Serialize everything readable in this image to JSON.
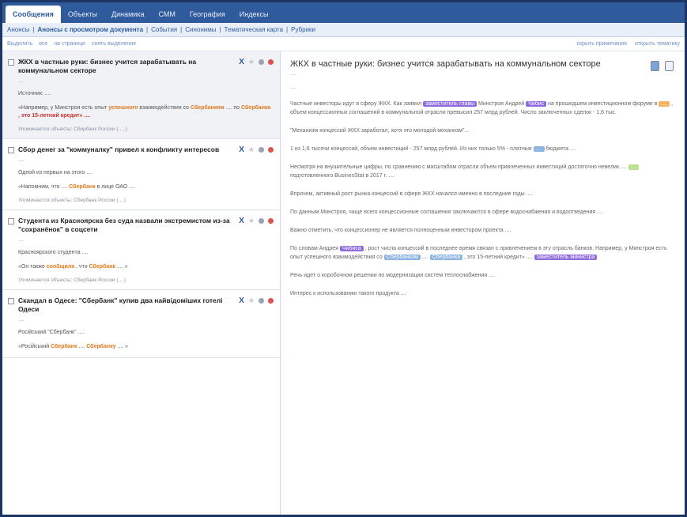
{
  "tabs": [
    {
      "label": "Сообщения",
      "active": true
    },
    {
      "label": "Объекты"
    },
    {
      "label": "Динамика"
    },
    {
      "label": "СММ"
    },
    {
      "label": "География"
    },
    {
      "label": "Индексы"
    }
  ],
  "subnav": {
    "items": [
      "Анонсы",
      "Анонсы с просмотром документа",
      "События",
      "Синонимы",
      "Тематическая карта",
      "Рубрики"
    ],
    "sep": "|"
  },
  "toolbar": {
    "left": [
      "Выделить",
      "все",
      "на странице",
      "снять выделение"
    ],
    "right": [
      "скрыть примечания",
      "открыть тематику"
    ]
  },
  "list": [
    {
      "title": "ЖКХ в частные руки: бизнес учится зарабатывать на коммунальном секторе",
      "meta": "....",
      "text_intro": "Источник: ....",
      "text_a": "«Например, у Минстроя есть опыт",
      "text_b": "успешного",
      "text_c": "взаимодействия со",
      "text_d": "Сбербанком",
      "text_e": ".... по",
      "text_f": "Сбербанка",
      "text_g": ", это 15-летний кредит» ....",
      "foot": "Упоминается объекты: Сбербанк России (.....)"
    },
    {
      "title": "Сбор денег за \"коммуналку\" привел к конфликту интересов",
      "meta": "....",
      "text_intro": "Одной из первых на этого ....",
      "text_a": "«Напомним, что",
      "text_b": "",
      "text_c": "....",
      "text_d": "Сбербанк",
      "text_e": "в лице ОАО ....",
      "text_f": "",
      "text_g": "",
      "foot": "Упоминается объекты: Сбербанк России (....)"
    },
    {
      "title": "Студента из Красноярска без суда назвали экстремистом из-за \"сохранёнок\" в соцсети",
      "meta": "....",
      "text_intro": "Красноярского студента ....",
      "text_a": "«Он также",
      "text_b": "сообщила",
      "text_c": ", что",
      "text_d": "Сбербанк",
      "text_e": ".... »",
      "text_f": "",
      "text_g": "",
      "foot": "Упоминается объекты: Сбербанк России (....)"
    },
    {
      "title": "Скандал в Одесе: \"Сбербанк\" купив два найвідоміших готелі Одеси",
      "meta": "....",
      "text_intro": "Російський \"Сбербанк\" ....",
      "text_a": "«Російський",
      "text_b": "",
      "text_c": "",
      "text_d": "Сбербанк",
      "text_e": "....",
      "text_f": "Сбербанку",
      "text_g": ".... »",
      "foot": ""
    }
  ],
  "doc": {
    "title": "ЖКХ в частные руки: бизнес учится зарабатывать на коммунальном секторе",
    "meta": "....",
    "sep": "....",
    "p1": {
      "a": "Частные инвесторы идут в сферу ЖКХ. Как заявил",
      "tag1": "заместитель главы",
      "b": "Минстроя Андрей",
      "tag2": "Чибис",
      "c": "на прошедшем инвестиционном форуме в",
      "tag3": "....",
      "d": ", объем концессионных соглашений в коммунальной отрасли превысил 257 млрд рублей. Число заключенных сделок - 1,6 тыс."
    },
    "p2": "\"Механизм концессий ЖКХ заработал, хотя это молодой механизм\"...",
    "p3": {
      "a": "1 из 1,6 тысячи концессий, объем инвестиций - 257 млрд рублей. Из них только 5% - платные",
      "tag1": "....",
      "b": "бюджета ...."
    },
    "p4": {
      "a": "Несмотря на внушительные цифры, по сравнению с масштабом отрасли объем привлеченных инвестиций достаточно невелик ....",
      "tag1": "....",
      "b": "подготовленного BusinesStat в 2017 г. ...."
    },
    "p5": "Впрочем, активный рост рынка концессий в сфере ЖКХ начался именно в последние годы ....",
    "p6": "По данным Минстроя, чаще всего концессионные соглашения заключаются в сфере водоснабжения и водоотведения ....",
    "p7": "Важно отметить, что концессионер не является полноценным инвестором проекта ....",
    "p8": {
      "a": "По словам Андрея",
      "tag1": "Чибиса",
      "b": ", рост числа концессий в последнее время связан с привлечением в эту отрасль банков. Например, у Минстроя есть опыт успешного взаимодействия со",
      "tag2": "Сбербанком",
      "c": "....",
      "tag3": "Сбербанка",
      "d": ", это 15-летний кредит» ....",
      "tag4": "заместитель министра"
    },
    "p9": "Речь идет о коробочном решении по модернизации систем теплоснабжения ....",
    "p10": "Интерес к использованию такого продукта ...."
  }
}
